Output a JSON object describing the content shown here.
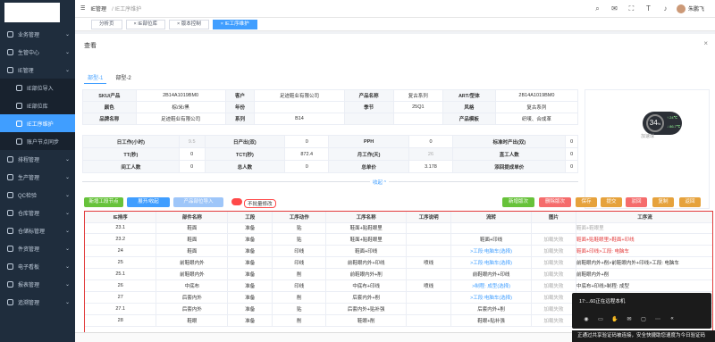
{
  "topbar": {
    "app": "IE管理",
    "crumb": "/ IE工序维护",
    "user": "朱鹏飞"
  },
  "sidebar": {
    "items": [
      {
        "label": "业务管理",
        "icon": "briefcase-icon",
        "expandable": true
      },
      {
        "label": "生管中心",
        "icon": "factory-icon",
        "expandable": true
      },
      {
        "label": "IE管理",
        "icon": "settings-icon",
        "expandable": true
      },
      {
        "label": "IE部位导入",
        "icon": "upload-icon",
        "sub": true
      },
      {
        "label": "IE部位库",
        "icon": "database-icon",
        "sub": true
      },
      {
        "label": "IE工序维护",
        "icon": "edit-icon",
        "sub": true,
        "active": true
      },
      {
        "label": "账户节点同步",
        "icon": "sync-icon",
        "sub": true
      },
      {
        "label": "排程管理",
        "icon": "calendar-icon",
        "expandable": true
      },
      {
        "label": "生产管理",
        "icon": "gear-icon",
        "expandable": true
      },
      {
        "label": "QC检验",
        "icon": "check-icon",
        "expandable": true
      },
      {
        "label": "仓库管理",
        "icon": "warehouse-icon",
        "expandable": true
      },
      {
        "label": "仓储标管理",
        "icon": "box-icon",
        "expandable": true
      },
      {
        "label": "件资管理",
        "icon": "money-icon",
        "expandable": true
      },
      {
        "label": "电子看板",
        "icon": "board-icon",
        "expandable": true
      },
      {
        "label": "报表管理",
        "icon": "report-icon",
        "expandable": true
      },
      {
        "label": "追溯管理",
        "icon": "trace-icon",
        "expandable": true
      }
    ]
  },
  "tabs": [
    {
      "label": "分析页"
    },
    {
      "label": "× IE部位库"
    },
    {
      "label": "× 版本控制"
    },
    {
      "label": "× IE工序维护",
      "active": true
    }
  ],
  "dialog": {
    "title": "查看",
    "subtabs": [
      {
        "label": "部型-1",
        "active": true
      },
      {
        "label": "部型-2"
      }
    ],
    "info1": [
      [
        "SKU/产品",
        "2B14A1019BM0",
        "客户",
        "足迹鞋业有限公司",
        "产品名称",
        "复古系列",
        "ART/型体",
        "2B14A1019BM0"
      ],
      [
        "颜色",
        "棕/米/黑",
        "年份",
        "",
        "季节",
        "25Q1",
        "风格",
        "复古系列"
      ],
      [
        "品牌名称",
        "足迹鞋业有限公司",
        "系列",
        "B14",
        "",
        "",
        "产品模板",
        "织唛、合成革"
      ]
    ],
    "info2": [
      [
        "日工作(小时)",
        "9.5",
        "日产出(双)",
        "0",
        "PPH",
        "0",
        "标准时产出(双)",
        "0"
      ],
      [
        "TT(秒)",
        "0",
        "TCT(秒)",
        "872.4",
        "月工作(天)",
        "26",
        "直工人数",
        "0"
      ],
      [
        "间工人数",
        "0",
        "总人数",
        "0",
        "总单价",
        "3.178",
        "添回提成单价",
        "0"
      ]
    ],
    "gauge": {
      "value": "34",
      "unit": "%",
      "up": "↑ 24℃",
      "down": "↓ 86.7℃",
      "caption": "加速球"
    },
    "collapse": "收起 ^",
    "left_buttons": [
      "新增工段节点",
      "展开/收起",
      "产品部位导入"
    ],
    "switch_label": "不批量修改",
    "right_buttons": [
      {
        "label": "新增版次",
        "color": "#67c23a"
      },
      {
        "label": "删除版次",
        "color": "#f56c6c"
      },
      {
        "label": "保存",
        "color": "#e6a23c"
      },
      {
        "label": "提交",
        "color": "#e6a23c"
      },
      {
        "label": "驳回",
        "color": "#f56c6c"
      },
      {
        "label": "复制",
        "color": "#e6a23c"
      },
      {
        "label": "返回",
        "color": "#e6a23c"
      }
    ],
    "grid": {
      "headers": [
        "IE排序",
        "部件名称",
        "工段",
        "工序动作",
        "工序名称",
        "工序说明",
        "流转",
        "图片",
        "工序流"
      ],
      "rows": [
        {
          "no": "23.1",
          "part": "鞋面",
          "stage": "准备",
          "act": "贴",
          "name": "鞋面+贴鞋眼里",
          "desc": "",
          "flow": "",
          "img": "",
          "flowline": "鞋面+鞋眼里",
          "fc": "grey"
        },
        {
          "no": "23.2",
          "part": "鞋面",
          "stage": "准备",
          "act": "贴",
          "name": "鞋面+贴鞋眼里",
          "desc": "",
          "flow": "鞋面+印线",
          "img": "加载失败",
          "flowline": "鞋面+贴鞋眼里>鞋面+印线",
          "fc": "red"
        },
        {
          "no": "24",
          "part": "鞋面",
          "stage": "准备",
          "act": "印线",
          "name": "鞋面+印线",
          "desc": "",
          "flow": ">工段:电脑车(选择)",
          "img": "加载失败",
          "flowline": "鞋面+印线>工段: 电脑车",
          "fc": "red"
        },
        {
          "no": "25",
          "part": "前鞋眼内外",
          "stage": "准备",
          "act": "印线",
          "name": "前鞋眼内外+印线",
          "desc": "喷线",
          "flow": ">工段:电脑车(选择)",
          "img": "加载失败",
          "flowline": "前鞋眼内外+削>前鞋眼内外+印线>工段: 电脑车",
          "fc": "mix"
        },
        {
          "no": "25.1",
          "part": "前鞋眼内外",
          "stage": "准备",
          "act": "削",
          "name": "前鞋眼内外+削",
          "desc": "",
          "flow": "前鞋眼内外+印线",
          "img": "加载失败",
          "flowline": "前鞋眼内外+削",
          "fc": ""
        },
        {
          "no": "26",
          "part": "中底布",
          "stage": "准备",
          "act": "印线",
          "name": "中底布+印线",
          "desc": "喷线",
          "flow": ">制程: 成型(选择)",
          "img": "加载失败",
          "flowline": "中底布+印线>制程: 成型",
          "fc": "mix"
        },
        {
          "no": "27",
          "part": "后套内外",
          "stage": "准备",
          "act": "削",
          "name": "后套内外+削",
          "desc": "",
          "flow": ">工段:电脑车(选择)",
          "img": "加载失败",
          "flowline": "后套内外+削>后套内外+贴补强",
          "fc": "mix"
        },
        {
          "no": "27.1",
          "part": "后套内外",
          "stage": "准备",
          "act": "贴",
          "name": "后套内外+贴补强",
          "desc": "",
          "flow": "后套内外+削",
          "img": "加载失败",
          "flowline": "后套内外+贴补强>工段: 电脑车",
          "fc": ""
        },
        {
          "no": "28",
          "part": "鞋眼",
          "stage": "准备",
          "act": "削",
          "name": "鞋眼+削",
          "desc": "",
          "flow": "鞋眼+贴补强",
          "img": "加载失败",
          "flowline": "鞋眼+贴补强>鞋眼+削>工段: 电脑车",
          "fc": "mix"
        }
      ]
    }
  },
  "recorder": {
    "text": "17:...60正在远程本机",
    "icons": [
      "mic-icon",
      "camera-icon",
      "hand-icon",
      "chat-icon",
      "folder-icon",
      "more-icon",
      "collapse-icon"
    ]
  },
  "statusbar": "正通过共享验证码被连接，安全快捷助您速度为今日验证码"
}
